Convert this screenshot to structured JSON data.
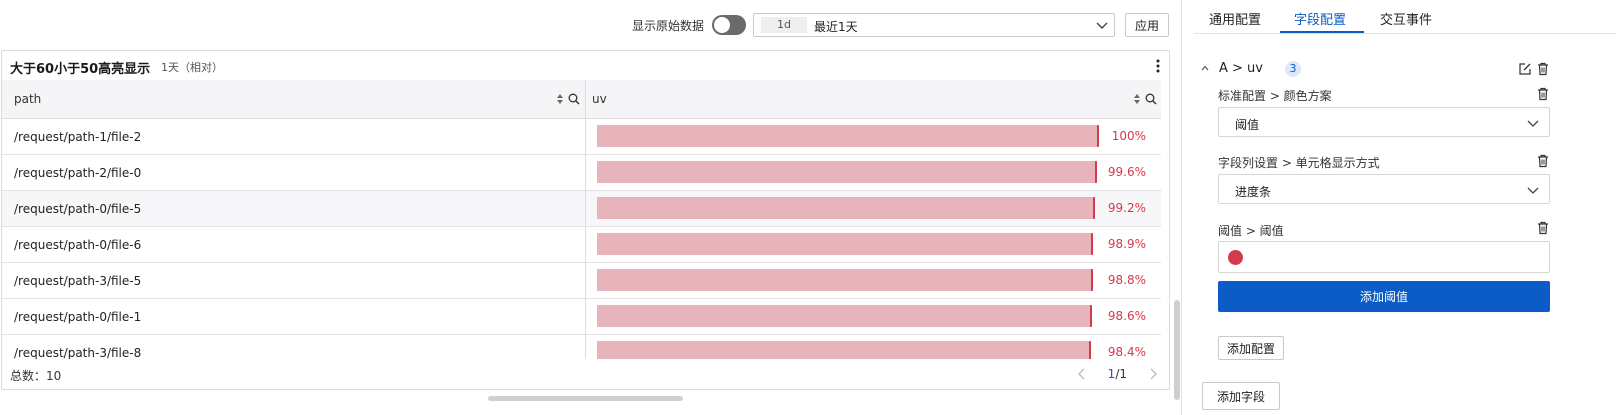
{
  "toolbar": {
    "show_raw_label": "显示原始数据",
    "time_tag": "1d",
    "time_text": "最近1天",
    "apply_label": "应用"
  },
  "panel": {
    "title": "大于60小于50高亮显示",
    "subtitle": "1天（相对）",
    "columns": [
      "path",
      "uv"
    ],
    "rows": [
      {
        "path": "/request/path-1/file-2",
        "uv_fraction": 1.0,
        "uv_text": "100%"
      },
      {
        "path": "/request/path-2/file-0",
        "uv_fraction": 0.996,
        "uv_text": "99.6%"
      },
      {
        "path": "/request/path-0/file-5",
        "uv_fraction": 0.992,
        "uv_text": "99.2%"
      },
      {
        "path": "/request/path-0/file-6",
        "uv_fraction": 0.989,
        "uv_text": "98.9%"
      },
      {
        "path": "/request/path-3/file-5",
        "uv_fraction": 0.988,
        "uv_text": "98.8%"
      },
      {
        "path": "/request/path-0/file-1",
        "uv_fraction": 0.986,
        "uv_text": "98.6%"
      },
      {
        "path": "/request/path-3/file-8",
        "uv_fraction": 0.984,
        "uv_text": "98.4%"
      }
    ],
    "total_label": "总数：",
    "total_value": "10",
    "page_current": "1",
    "page_total": "/1",
    "bar_color": "#e8b4bb",
    "bar_edge_color": "#d13b4d"
  },
  "right": {
    "tabs": [
      "通用配置",
      "字段配置",
      "交互事件"
    ],
    "active_tab": 1,
    "field_name": "A > uv",
    "field_count": "3",
    "configs": [
      {
        "label": "标准配置 > 颜色方案",
        "value": "阈值"
      },
      {
        "label": "字段列设置 > 单元格显示方式",
        "value": "进度条"
      }
    ],
    "threshold_label": "阈值 > 阈值",
    "threshold_color": "#d13b4d",
    "add_threshold_label": "添加阈值",
    "add_config_label": "添加配置",
    "add_field_label": "添加字段",
    "accent_color": "#0b5cc6"
  }
}
